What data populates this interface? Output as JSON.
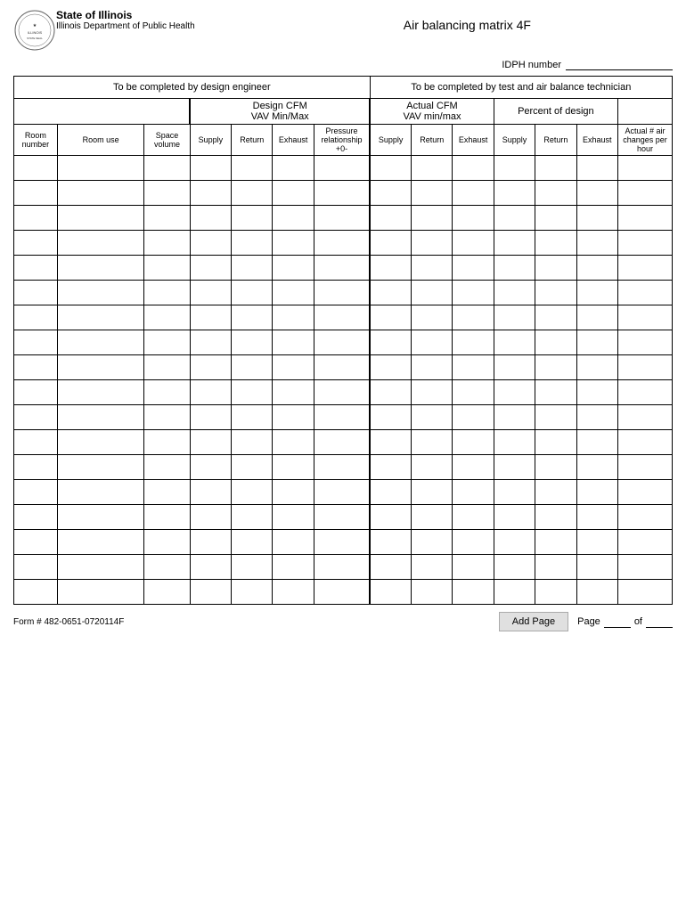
{
  "header": {
    "state_name": "State of Illinois",
    "dept_name": "Illinois Department of Public Health",
    "title": "Air balancing matrix  4F",
    "idph_label": "IDPH number"
  },
  "section_left_header": "To be completed by  design engineer",
  "section_right_header": "To be completed by test and air balance technician",
  "design_cfm_label": "Design CFM",
  "design_cfm_sub": "VAV Min/Max",
  "actual_cfm_label": "Actual CFM",
  "actual_cfm_sub": "VAV min/max",
  "percent_label": "Percent of design",
  "columns": [
    {
      "id": "room_number",
      "label": "Room number",
      "section": "left"
    },
    {
      "id": "room_use",
      "label": "Room use",
      "section": "left"
    },
    {
      "id": "space_volume",
      "label": "Space volume",
      "section": "left"
    },
    {
      "id": "supply_design",
      "label": "Supply",
      "section": "design"
    },
    {
      "id": "return_design",
      "label": "Return",
      "section": "design"
    },
    {
      "id": "exhaust_design",
      "label": "Exhaust",
      "section": "design"
    },
    {
      "id": "pressure_rel",
      "label": "Pressure relationship +0-",
      "section": "design"
    },
    {
      "id": "supply_actual",
      "label": "Supply",
      "section": "actual"
    },
    {
      "id": "return_actual",
      "label": "Return",
      "section": "actual"
    },
    {
      "id": "exhaust_actual",
      "label": "Exhaust",
      "section": "actual"
    },
    {
      "id": "supply_percent",
      "label": "Supply",
      "section": "percent"
    },
    {
      "id": "return_percent",
      "label": "Return",
      "section": "percent"
    },
    {
      "id": "exhaust_percent",
      "label": "Exhaust",
      "section": "percent"
    },
    {
      "id": "air_changes",
      "label": "Actual # air changes per hour",
      "section": "right"
    }
  ],
  "data_rows": 18,
  "footer": {
    "form_number": "Form # 482-0651-0720114F",
    "add_page_label": "Add Page",
    "page_label": "Page",
    "of_label": "of"
  }
}
